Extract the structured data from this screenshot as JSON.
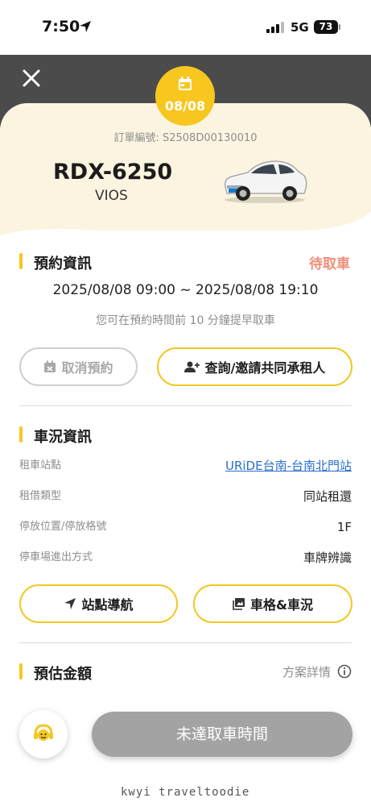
{
  "status_bar": {
    "time": "7:50",
    "network": "5G",
    "battery": "73"
  },
  "header": {
    "date_badge": "08/08"
  },
  "order": {
    "number_label": "訂單編號: S2508D00130010",
    "plate": "RDX-6250",
    "model": "VIOS"
  },
  "booking": {
    "title": "預約資訊",
    "status": "待取車",
    "time_range": "2025/08/08 09:00 ~ 2025/08/08 19:10",
    "hint": "您可在預約時間前 10 分鐘提早取車",
    "cancel_label": "取消預約",
    "invite_label": "查詢/邀請共同承租人"
  },
  "vehicle": {
    "title": "車況資訊",
    "rows": [
      {
        "label": "租車站點",
        "value": "URiDE台南-台南北門站"
      },
      {
        "label": "租借類型",
        "value": "同站租還"
      },
      {
        "label": "停放位置/停放格號",
        "value": "1F"
      },
      {
        "label": "停車場進出方式",
        "value": "車牌辨識"
      }
    ],
    "nav_label": "站點導航",
    "slot_label": "車格&車況"
  },
  "estimate": {
    "title": "預估金額",
    "plan_detail": "方案詳情"
  },
  "footer": {
    "main_button": "未達取車時間",
    "watermark": "kwyi traveltoodie"
  },
  "colors": {
    "accent": "#f7c71f",
    "header": "#4b4b4b",
    "pending": "#ee8f78",
    "link": "#2a6fc9",
    "disabled": "#a3a3a3"
  },
  "icons": [
    "location-arrow-icon",
    "signal-icon",
    "close-icon",
    "calendar-icon",
    "calendar-cancel-icon",
    "person-add-icon",
    "navigation-arrow-icon",
    "image-icon",
    "info-icon",
    "customer-service-icon"
  ]
}
